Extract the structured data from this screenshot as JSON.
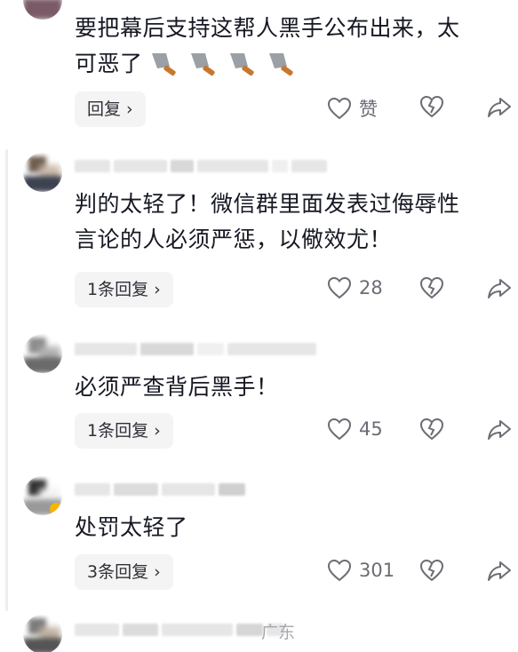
{
  "comments": [
    {
      "text_line1": "要把幕后支持这帮人黑手公布出来，太",
      "text_line2": "可恶了",
      "emoji": "kitchen-knife x4",
      "reply_label": "回复",
      "like_label": "赞"
    },
    {
      "text_line1": "判的太轻了！微信群里面发表过侮辱性",
      "text_line2": "言论的人必须严惩，以儆效尤！",
      "reply_label": "1条回复",
      "likes": "28"
    },
    {
      "text_line1": "必须严查背后黑手！",
      "reply_label": "1条回复",
      "likes": "45"
    },
    {
      "text_line1": "处罚太轻了",
      "reply_label": "3条回复",
      "likes": "301"
    },
    {
      "location": "广东"
    }
  ],
  "icons": {
    "like": "heart-outline-icon",
    "dislike": "broken-heart-icon",
    "share": "share-arrow-icon",
    "chevron": "chevron-right-icon"
  },
  "colors": {
    "text": "#161823",
    "muted": "#6b6d74",
    "button_bg": "#f4f4f5",
    "location": "#a6a8ae"
  }
}
